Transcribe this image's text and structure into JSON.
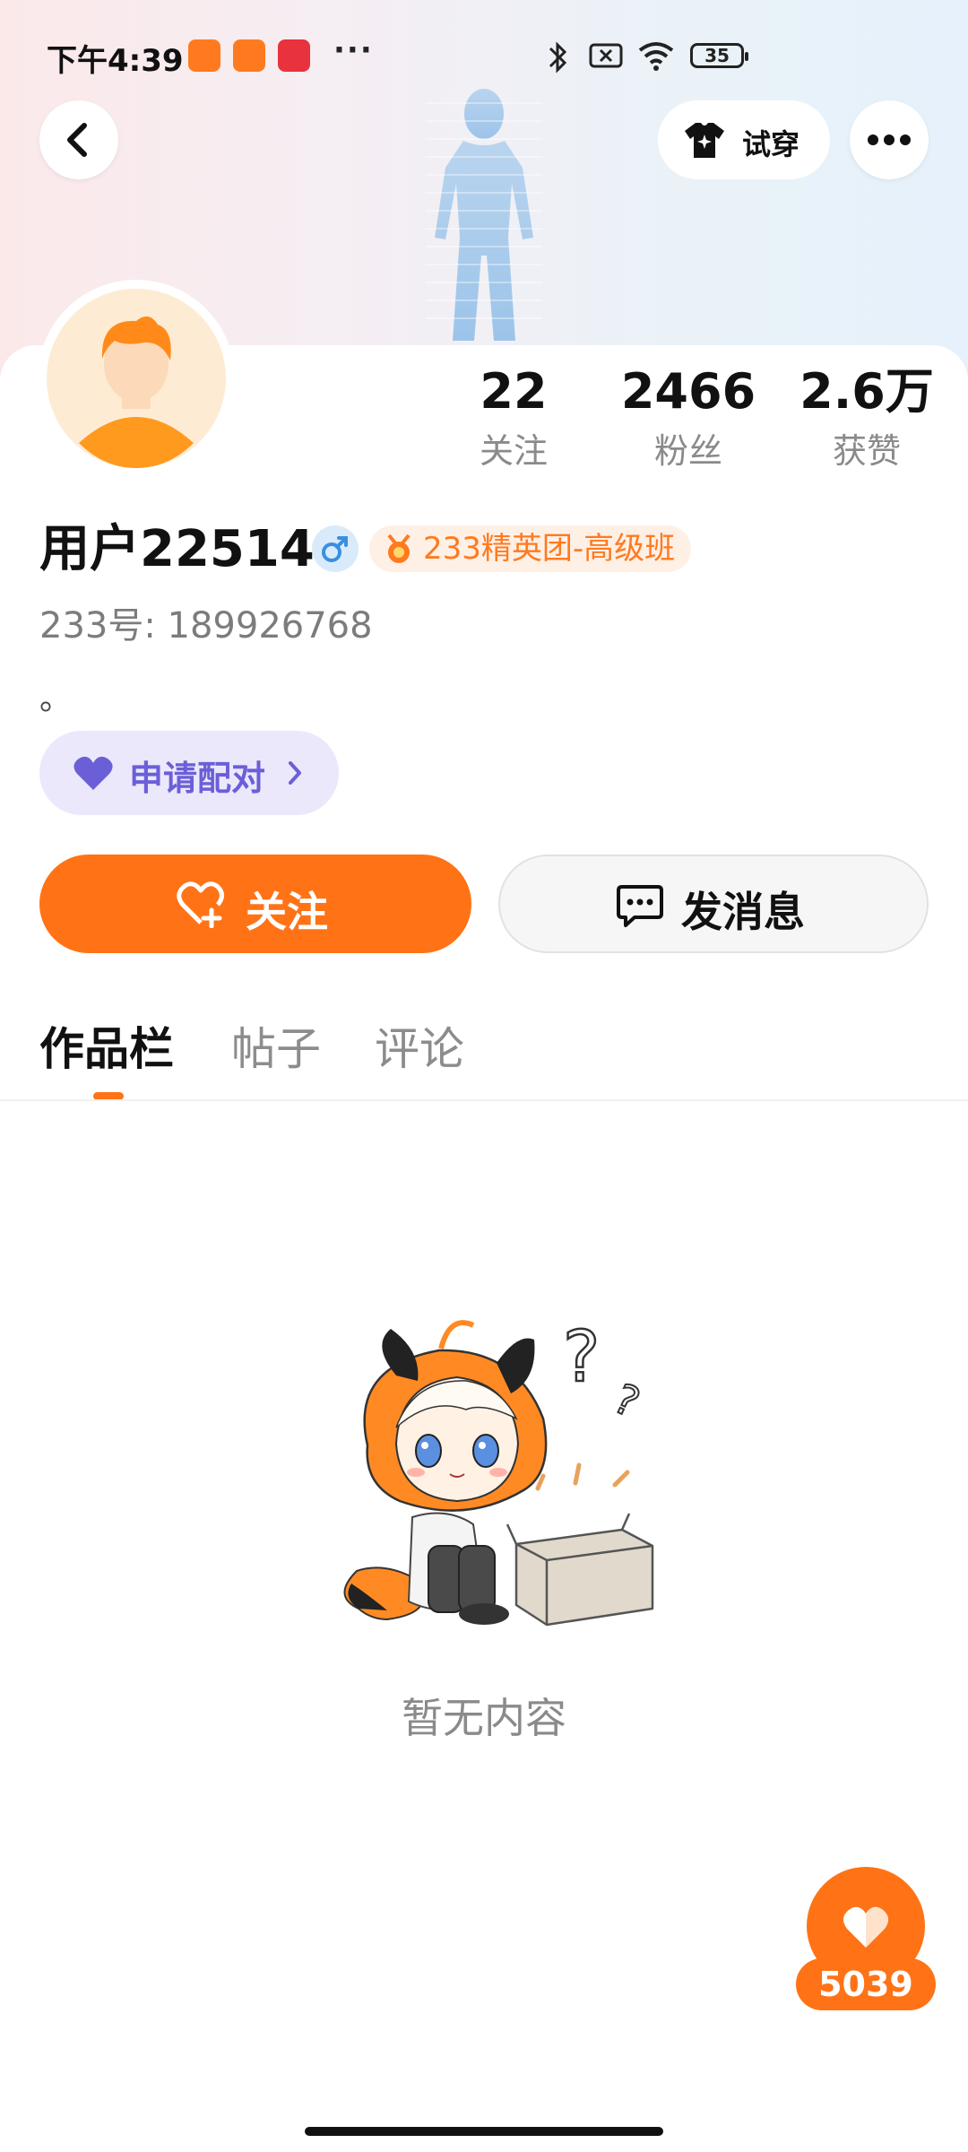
{
  "status_bar": {
    "time": "下午4:39",
    "more": "···",
    "battery": "35"
  },
  "header": {
    "try_on_label": "试穿"
  },
  "profile": {
    "username": "用户225141",
    "rank_badge": "233精英团-高级班",
    "user_id": "233号: 189926768",
    "bio": "。",
    "stats": [
      {
        "value": "22",
        "label": "关注"
      },
      {
        "value": "2466",
        "label": "粉丝"
      },
      {
        "value": "2.6万",
        "label": "获赞"
      }
    ]
  },
  "actions": {
    "pair_label": "申请配对",
    "follow_label": "关注",
    "message_label": "发消息"
  },
  "tabs": [
    {
      "label": "作品栏",
      "active": true
    },
    {
      "label": "帖子",
      "active": false
    },
    {
      "label": "评论",
      "active": false
    }
  ],
  "empty_state": {
    "text": "暂无内容"
  },
  "like_fab": {
    "count": "5039"
  },
  "colors": {
    "accent": "#ff7316",
    "pair_bg": "#ebe8fb",
    "pair_text": "#6b5fd8"
  }
}
